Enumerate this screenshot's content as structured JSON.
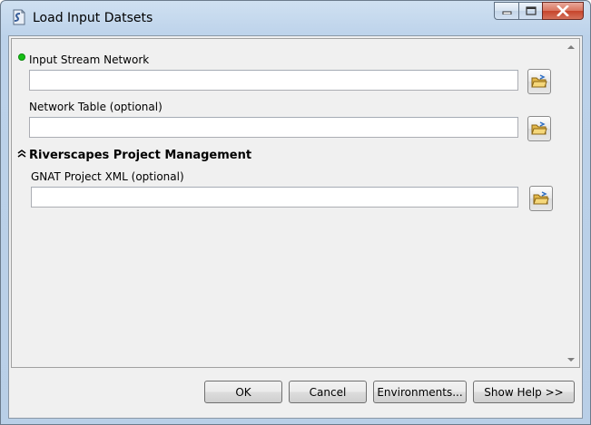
{
  "window": {
    "title": "Load Input Datsets",
    "icon": "python-script-icon"
  },
  "caption_buttons": [
    "minimize-icon",
    "maximize-icon",
    "close-icon"
  ],
  "params": {
    "input_stream_network": {
      "label": "Input Stream Network",
      "value": "",
      "required": true,
      "indicator_color": "#16c016"
    },
    "network_table": {
      "label": "Network Table (optional)",
      "value": ""
    }
  },
  "section": {
    "label": "Riverscapes Project Management",
    "icon": "collapse-chevron-icon",
    "params": {
      "gnat_project_xml": {
        "label": "GNAT Project XML (optional)",
        "value": ""
      }
    }
  },
  "buttons": {
    "ok": "OK",
    "cancel": "Cancel",
    "environments": "Environments...",
    "show_help": "Show Help >>"
  }
}
